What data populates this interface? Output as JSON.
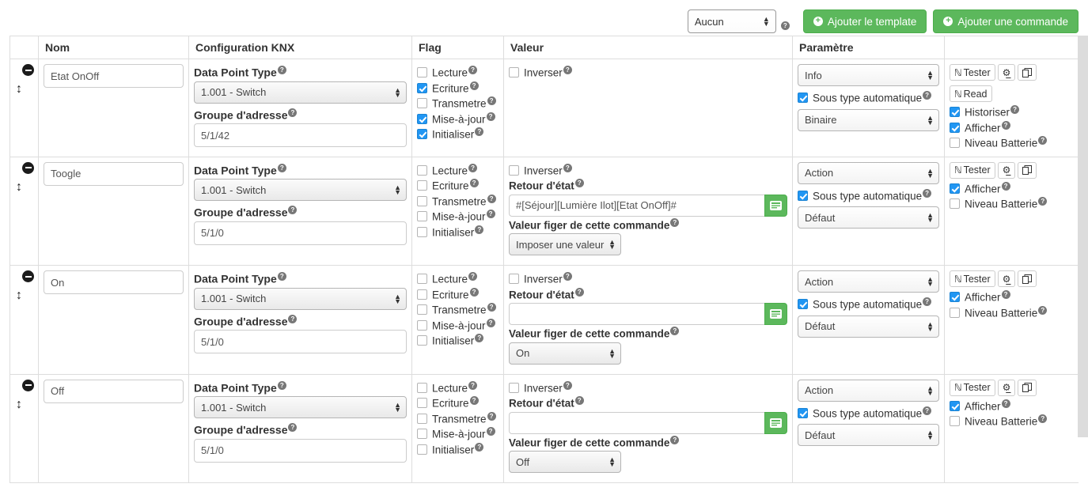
{
  "toolbar": {
    "template_select_value": "Aucun",
    "help_icon": "help-circle-icon",
    "add_template_label": "Ajouter le template",
    "add_command_label": "Ajouter une commande",
    "accent_green": "#5cb85c"
  },
  "table": {
    "headers": [
      "",
      "Nom",
      "Configuration KNX",
      "Flag",
      "Valeur",
      "Paramètre",
      ""
    ],
    "labels": {
      "dpt": "Data Point Type",
      "group_address": "Groupe d'adresse",
      "retour_etat": "Retour d'état",
      "valeur_figer": "Valeur figer de cette commande",
      "sous_type_auto": "Sous type automatique",
      "inverser": "Inverser",
      "flags": [
        "Lecture",
        "Ecriture",
        "Transmetre",
        "Mise-à-jour",
        "Initialiser"
      ],
      "tester": "Tester",
      "read": "Read",
      "historiser": "Historiser",
      "afficher": "Afficher",
      "niveau_batterie": "Niveau Batterie"
    },
    "rows": [
      {
        "name": "Etat OnOff",
        "dpt": "1.001 - Switch",
        "group_address": "5/1/42",
        "flags": [
          false,
          true,
          false,
          true,
          true
        ],
        "inverser": false,
        "has_retour_etat": false,
        "retour_etat": "",
        "has_valeur_figer": false,
        "valeur_figer": "",
        "type": "Info",
        "sous_type_auto": true,
        "sub_type": "Binaire",
        "has_read": true,
        "has_historiser": true,
        "historiser": true,
        "afficher": true,
        "niveau_batterie": false
      },
      {
        "name": "Toogle",
        "dpt": "1.001 - Switch",
        "group_address": "5/1/0",
        "flags": [
          false,
          false,
          false,
          false,
          false
        ],
        "inverser": false,
        "has_retour_etat": true,
        "retour_etat": "#[Séjour][Lumière Ilot][Etat OnOff]#",
        "has_valeur_figer": true,
        "valeur_figer": "Imposer une valeur",
        "type": "Action",
        "sous_type_auto": true,
        "sub_type": "Défaut",
        "has_read": false,
        "has_historiser": false,
        "historiser": false,
        "afficher": true,
        "niveau_batterie": false
      },
      {
        "name": "On",
        "dpt": "1.001 - Switch",
        "group_address": "5/1/0",
        "flags": [
          false,
          false,
          false,
          false,
          false
        ],
        "inverser": false,
        "has_retour_etat": true,
        "retour_etat": "",
        "has_valeur_figer": true,
        "valeur_figer": "On",
        "type": "Action",
        "sous_type_auto": true,
        "sub_type": "Défaut",
        "has_read": false,
        "has_historiser": false,
        "historiser": false,
        "afficher": true,
        "niveau_batterie": false
      },
      {
        "name": "Off",
        "dpt": "1.001 - Switch",
        "group_address": "5/1/0",
        "flags": [
          false,
          false,
          false,
          false,
          false
        ],
        "inverser": false,
        "has_retour_etat": true,
        "retour_etat": "",
        "has_valeur_figer": true,
        "valeur_figer": "Off",
        "type": "Action",
        "sous_type_auto": true,
        "sub_type": "Défaut",
        "has_read": false,
        "has_historiser": false,
        "historiser": false,
        "afficher": true,
        "niveau_batterie": false
      }
    ]
  }
}
